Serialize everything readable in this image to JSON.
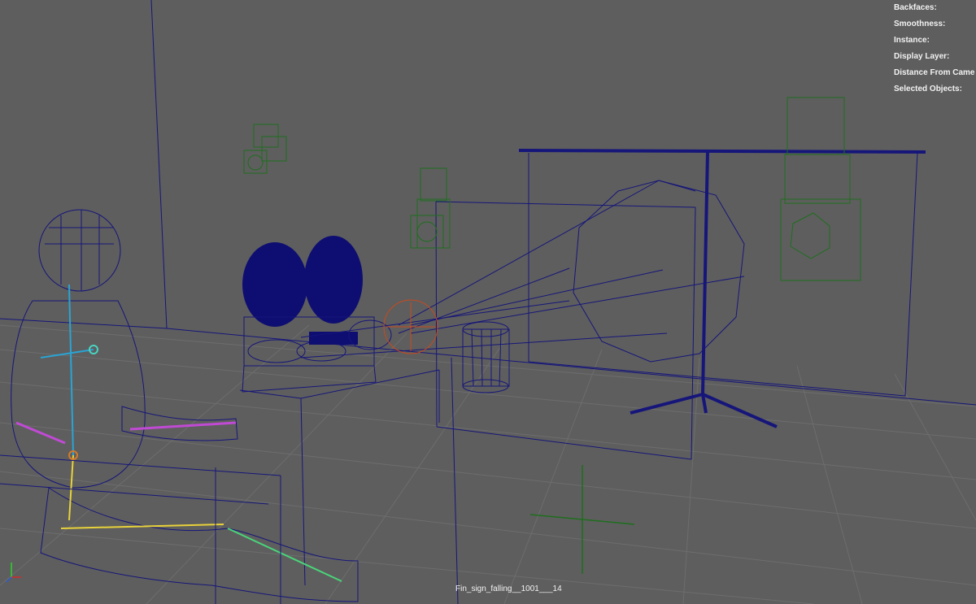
{
  "hud": {
    "backfaces_label": "Backfaces:",
    "smoothness_label": "Smoothness:",
    "instance_label": "Instance:",
    "display_layer_label": "Display Layer:",
    "distance_label": "Distance From Came",
    "selected_label": "Selected Objects:"
  },
  "camera": {
    "name": "Fin_sign_falling__1001___14"
  },
  "colors": {
    "background": "#5e5e5e",
    "grid": "#6d6d6d",
    "wireframe": "#16167a",
    "wire_green": "#1e6e1e",
    "wire_red": "#c84a1e",
    "hud_text": "#f2f2f2"
  },
  "icons": {
    "axis_gizmo": "axis-gizmo-icon",
    "view_pivot": "crosshair-icon"
  }
}
